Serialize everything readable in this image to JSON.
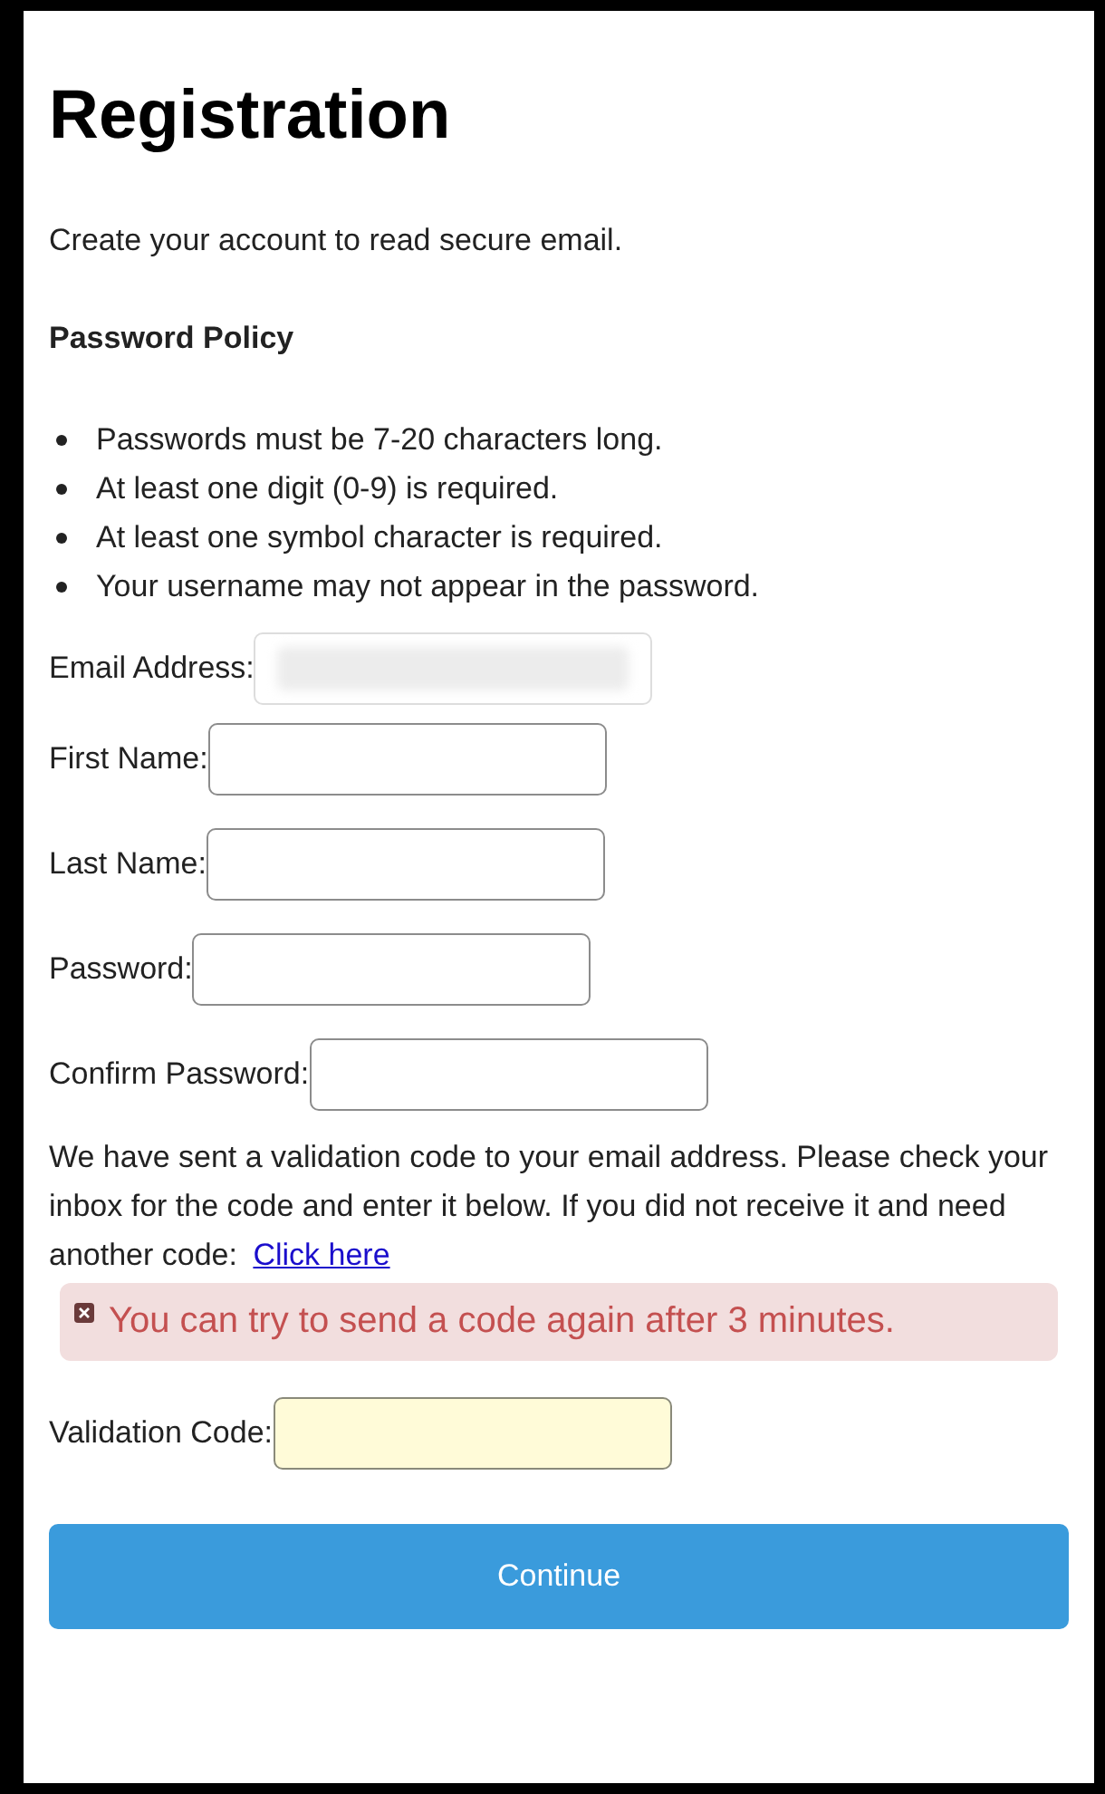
{
  "title": "Registration",
  "intro": "Create your account to read secure email.",
  "policy": {
    "heading": "Password Policy",
    "rules": [
      "Passwords must be 7-20 characters long.",
      "At least one digit (0-9) is required.",
      "At least one symbol character is required.",
      "Your username may not appear in the password."
    ]
  },
  "fields": [
    {
      "label": "Email Address:",
      "blurred": true,
      "highlighted": false
    },
    {
      "label": "First Name:",
      "blurred": false,
      "highlighted": false
    },
    {
      "label": "Last Name:",
      "blurred": false,
      "highlighted": false
    },
    {
      "label": "Password:",
      "blurred": false,
      "highlighted": false
    },
    {
      "label": "Confirm Password:",
      "blurred": false,
      "highlighted": false
    }
  ],
  "notice": {
    "text": "We have sent a validation code to your email address. Please check your inbox for the code and enter it below. If you did not receive it and need another code:",
    "link": "Click here"
  },
  "error": "You can try to send a code again after 3 minutes.",
  "validation": {
    "label": "Validation Code:",
    "blurred": false,
    "highlighted": true
  },
  "button": "Continue"
}
